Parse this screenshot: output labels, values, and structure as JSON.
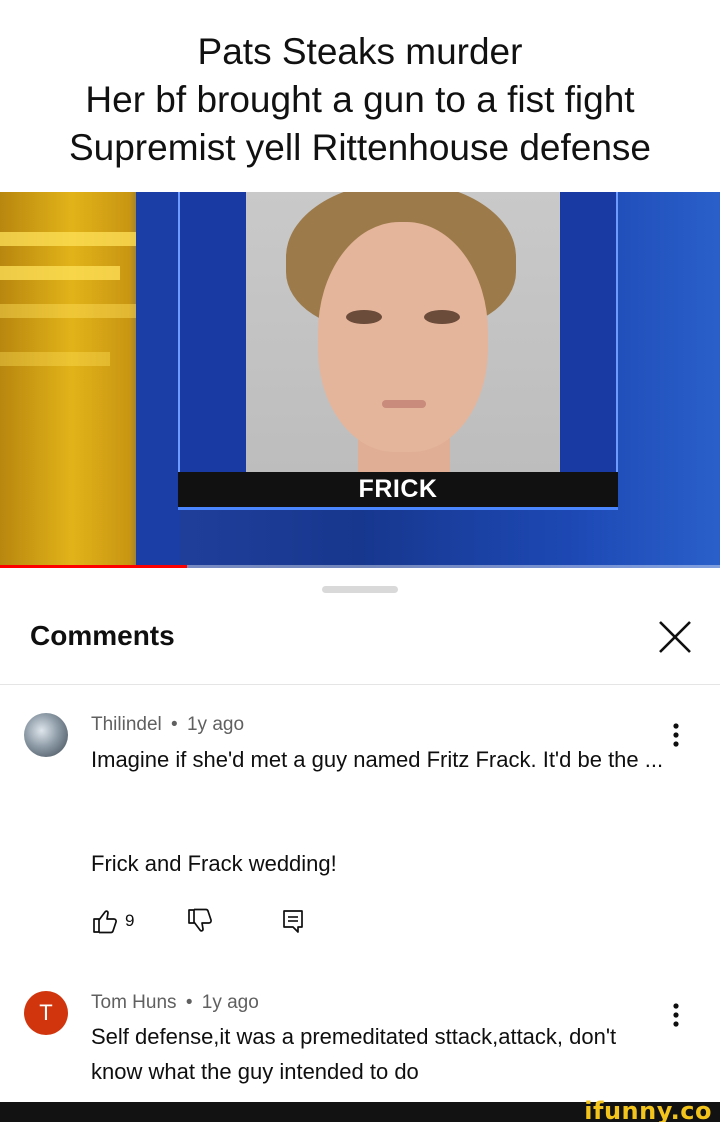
{
  "caption": {
    "lines": [
      "Pats Steaks murder",
      "Her bf brought a gun to a fist fight",
      "Supremist yell Rittenhouse defense"
    ]
  },
  "video": {
    "name_banner": "FRICK",
    "progress": 0.26,
    "progress_color": "#ff0000"
  },
  "comments_panel": {
    "title": "Comments",
    "close_icon": "close-icon",
    "comments": [
      {
        "author": "Thilindel",
        "separator": "•",
        "age": "1y ago",
        "text_line1": "Imagine if she'd met a guy named Fritz Frack.  It'd be the ...",
        "text_line2": "Frick and Frack wedding!",
        "likes": "9",
        "avatar": "avatar-photo"
      },
      {
        "author": "Tom Huns",
        "separator": "•",
        "age": "1y ago",
        "avatar_letter": "T",
        "avatar_color": "#d0350d",
        "text": "Self defense,it was a premeditated sttack,attack, don't know what the guy intended to do"
      }
    ]
  },
  "watermark": {
    "text": "ifunny.co",
    "color": "#f3c41c"
  }
}
